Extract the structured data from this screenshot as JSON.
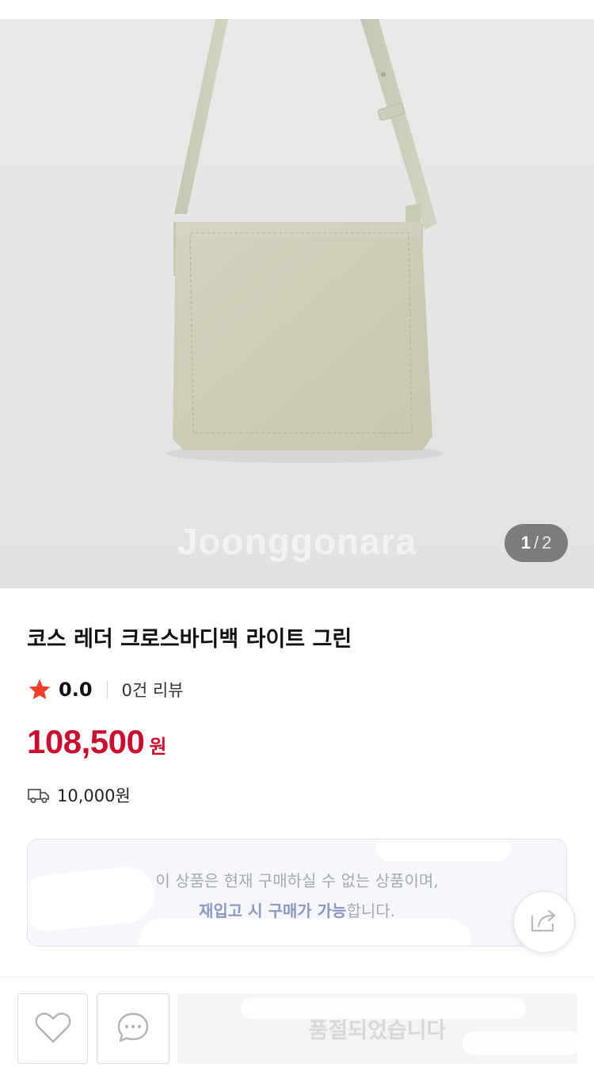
{
  "gallery": {
    "watermark": "Joonggonara",
    "pager": {
      "current": "1",
      "separator": "/",
      "total": "2"
    }
  },
  "product": {
    "title": "코스 레더 크로스바디백 라이트 그린",
    "rating": "0.0",
    "review_count": "0건 리뷰",
    "price": "108,500",
    "currency": "원",
    "shipping_fee": "10,000원"
  },
  "notice": {
    "line1": "이 상품은 현재 구매하실 수 없는 상품이며,",
    "line2_emphasis": "재입고 시 구매가 가능",
    "line2_rest": "합니다."
  },
  "actions": {
    "soldout_label": "품절되었습니다"
  },
  "icons": {
    "rating": "star-icon",
    "shipping": "truck-icon",
    "share": "share-icon",
    "wish": "heart-icon",
    "chat": "chat-bubble-icon"
  },
  "colors": {
    "price": "#c8102e",
    "star": "#ec3e28",
    "bag": "#cfcfb9"
  }
}
